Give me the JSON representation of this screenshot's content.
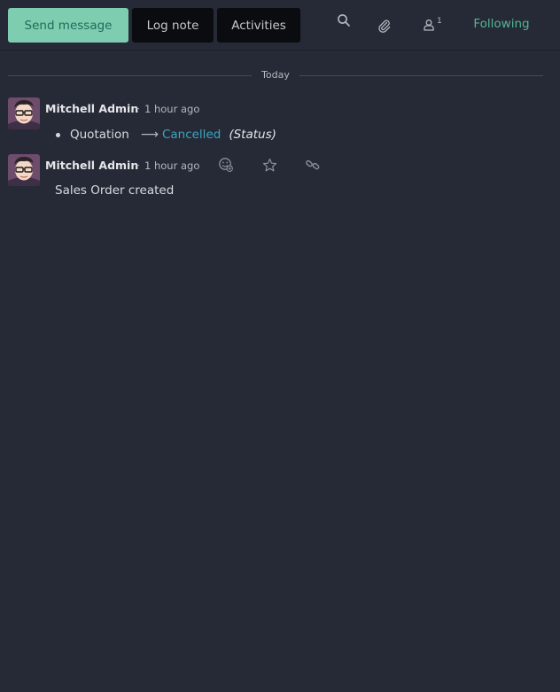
{
  "topbar": {
    "send_message_label": "Send message",
    "log_note_label": "Log note",
    "activities_label": "Activities",
    "follower_count": "1",
    "following_label": "Following"
  },
  "separator": {
    "label": "Today"
  },
  "messages": [
    {
      "author": "Mitchell Admin",
      "dash": "-",
      "date": "1 hour ago",
      "tracking": {
        "old_value": "Quotation",
        "new_value": "Cancelled",
        "field_name": "(Status)"
      }
    },
    {
      "author": "Mitchell Admin",
      "dash": "-",
      "date": "1 hour ago",
      "body": "Sales Order created"
    }
  ],
  "colors": {
    "background": "#262a36",
    "primary_button": "#7fcdb0",
    "following": "#54b694",
    "tracking_new_value": "#3aa4c0"
  },
  "icons": [
    "search-icon",
    "paperclip-icon",
    "user-icon",
    "add-reaction-icon",
    "star-icon",
    "link-icon"
  ]
}
